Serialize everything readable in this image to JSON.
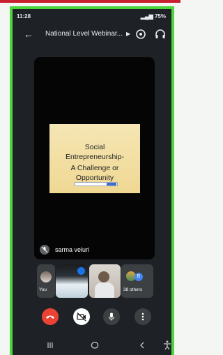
{
  "status_bar": {
    "time": "11:28",
    "battery": "75%"
  },
  "header": {
    "title": "National Level Webinar..."
  },
  "presentation": {
    "slide_lines": [
      "Social",
      "Entrepreneurship-",
      "A Challenge or",
      "Opportunity"
    ],
    "presenter_name": "sarma veluri"
  },
  "participants": {
    "you_label": "You",
    "others_label": "38 others",
    "others_initial": "B"
  },
  "colors": {
    "frame": "#4cd63c",
    "end_call": "#ea4335",
    "accent": "#1a73e8"
  }
}
